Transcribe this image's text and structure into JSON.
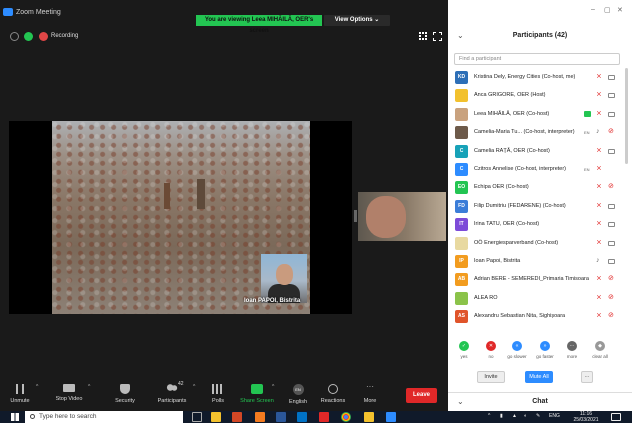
{
  "window": {
    "app_title": "Zoom Meeting"
  },
  "banner": {
    "viewing": "You are viewing Leea MIHĂILĂ, OER's screen",
    "view_options": "View Options ⌄"
  },
  "recording": {
    "label": "Recording"
  },
  "screen": {
    "speaker_name": "Ioan PAPOI, Bistrita"
  },
  "toolbar": {
    "unmute": "Unmute",
    "stop_video": "Stop Video",
    "security": "Security",
    "participants": "Participants",
    "participants_count": "42",
    "polls": "Polls",
    "share_screen": "Share Screen",
    "english": "English",
    "english_icon": "EN",
    "reactions": "Reactions",
    "more": "More",
    "leave": "Leave"
  },
  "panel": {
    "title": "Participants (42)",
    "search_placeholder": "Find a participant",
    "participants": [
      {
        "initials": "KD",
        "name": "Kristina Dely, Energy Cities (Co-host, me)",
        "color": "#2d6fb7",
        "mic": "off",
        "video": "on"
      },
      {
        "initials": "",
        "name": "Anca GRIGORE, OER (Host)",
        "color": "#f2c12e",
        "mic": "off",
        "video": "on"
      },
      {
        "initials": "",
        "name": "Leea MIHĂILĂ, OER (Co-host)",
        "color": "#c9a27e",
        "mic": "off",
        "video": "on",
        "sharing": true
      },
      {
        "initials": "",
        "name": "Camelia-Maria Tu... (Co-host, interpreter)",
        "color": "#6d5a4a",
        "mic": "on",
        "video": "off",
        "interpreter": "EN"
      },
      {
        "initials": "C",
        "name": "Camelia RAȚĂ, OER (Co-host)",
        "color": "#17a2b8",
        "mic": "off",
        "video": "on"
      },
      {
        "initials": "C",
        "name": "Czitros Annelise (Co-host, interpreter)",
        "color": "#2d8cff",
        "mic": "off",
        "video": "none",
        "interpreter": "EN"
      },
      {
        "initials": "EO",
        "name": "Echipa OER (Co-host)",
        "color": "#23c552",
        "mic": "off",
        "video": "off"
      },
      {
        "initials": "FD",
        "name": "Filip Dumitriu (FEDARENE) (Co-host)",
        "color": "#3b7dd8",
        "mic": "off",
        "video": "on"
      },
      {
        "initials": "IT",
        "name": "Irina TATU, OER (Co-host)",
        "color": "#7d4bd8",
        "mic": "off",
        "video": "on"
      },
      {
        "initials": "",
        "name": "OÖ Energiesparverband (Co-host)",
        "color": "#e8d9a0",
        "mic": "off",
        "video": "on"
      },
      {
        "initials": "IP",
        "name": "Ioan Papoi, Bistrita",
        "color": "#f29c1f",
        "mic": "on",
        "video": "on"
      },
      {
        "initials": "AB",
        "name": "Adrian BERE - SEMEREDI_Primaria Timisoara",
        "color": "#f29c1f",
        "mic": "off",
        "video": "off"
      },
      {
        "initials": "",
        "name": "ALEA RO",
        "color": "#8bc34a",
        "mic": "off",
        "video": "off"
      },
      {
        "initials": "AS",
        "name": "Alexandru Sebastian Nita, Sighișoara",
        "color": "#e0542a",
        "mic": "off",
        "video": "off"
      }
    ],
    "reactions": [
      {
        "label": "yes",
        "color": "#23c552",
        "glyph": "✓"
      },
      {
        "label": "no",
        "color": "#e02828",
        "glyph": "✕"
      },
      {
        "label": "go slower",
        "color": "#2d8cff",
        "glyph": "«"
      },
      {
        "label": "go faster",
        "color": "#2d8cff",
        "glyph": "»"
      },
      {
        "label": "more",
        "color": "#666666",
        "glyph": "···"
      },
      {
        "label": "clear all",
        "color": "#999999",
        "glyph": "◆"
      }
    ],
    "invite": "Invite",
    "mute_all": "Mute All",
    "more_btn": "...",
    "chat_title": "Chat"
  },
  "taskbar": {
    "search_placeholder": "Type here to search",
    "lang": "ENG",
    "time": "11:16",
    "date": "25/03/2021"
  }
}
